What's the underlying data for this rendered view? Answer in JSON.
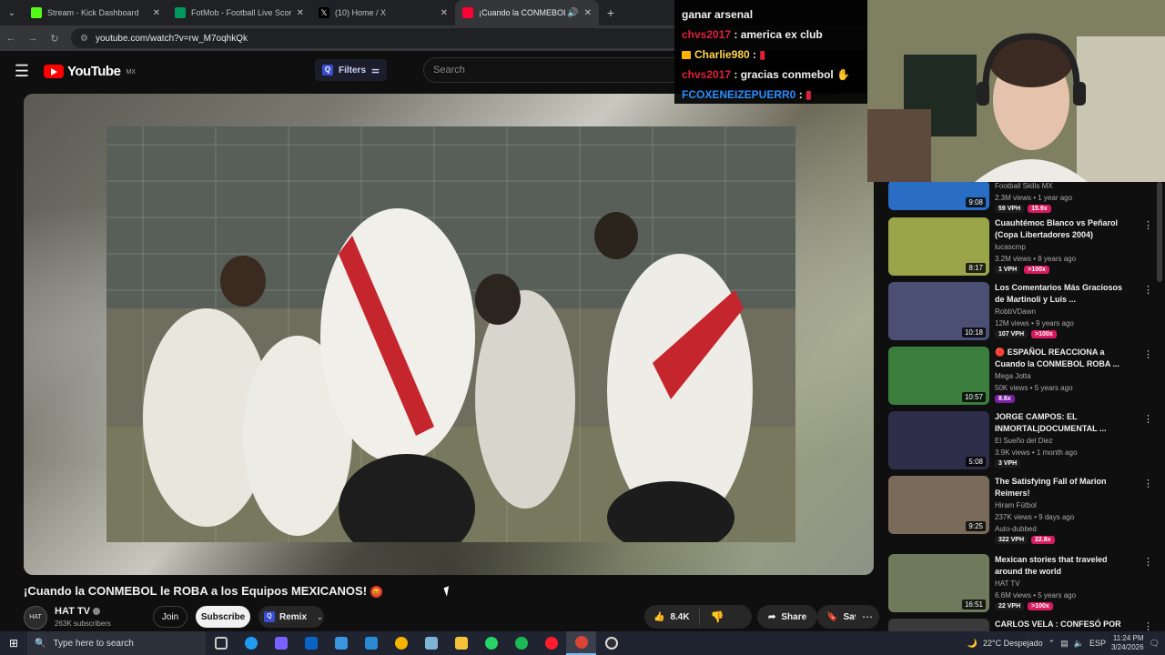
{
  "browser": {
    "tabs": [
      {
        "title": "Stream - Kick Dashboard",
        "favicon_color": "#53fc18",
        "active": false
      },
      {
        "title": "FotMob - Football Live Scores",
        "favicon_color": "#00985f",
        "active": false
      },
      {
        "title": "(10) Home / X",
        "favicon_color": "#000000",
        "active": false
      },
      {
        "title": "¡Cuando la CONMEBOL le R",
        "favicon_color": "#ff0033",
        "active": true
      }
    ],
    "new_tab": "+",
    "url": "youtube.com/watch?v=rw_M7oqhkQk"
  },
  "youtube": {
    "logo_text": "YouTube",
    "country_code": "MX",
    "filters_label": "Filters",
    "search_placeholder": "Search"
  },
  "chat": {
    "messages": [
      {
        "user": "",
        "text": "ganar arsenal"
      },
      {
        "user": "chvs2017",
        "text": " : america ex club"
      },
      {
        "user": "Charlie980",
        "text": " : "
      },
      {
        "user": "chvs2017",
        "text": " : gracias conmebol"
      },
      {
        "user": "FCOXENEIZEPUERR0",
        "text": " : "
      }
    ]
  },
  "video": {
    "title": "¡Cuando la CONMEBOL le ROBA a los Equipos MEXICANOS!",
    "channel": "HAT TV",
    "subscribers": "263K subscribers",
    "avatar_text": "HAT",
    "join_label": "Join",
    "subscribe_label": "Subscribe",
    "remix_label": "Remix",
    "likes": "8.4K",
    "share_label": "Share",
    "save_label": "Save"
  },
  "recommendations": [
    {
      "title": "",
      "channel": "Football Skills MX",
      "stats": "2.3M views • 1 year ago",
      "duration": "9:08",
      "vph": "59 VPH",
      "multiplier": "15.9x",
      "thumb_color": "#2a6dc4"
    },
    {
      "title": "Cuauhtémoc Blanco vs Peñarol (Copa Libertadores 2004)",
      "channel": "lucascmp",
      "stats": "3.2M views • 8 years ago",
      "duration": "8:17",
      "vph": "1 VPH",
      "multiplier": ">100x",
      "thumb_color": "#9aa54a"
    },
    {
      "title": "Los Comentarios Más Graciosos de Martinoli y Luis ...",
      "channel": "RobbVDawn",
      "stats": "12M views • 9 years ago",
      "duration": "10:18",
      "vph": "107 VPH",
      "multiplier": ">100x",
      "thumb_color": "#4b4f74"
    },
    {
      "title": "🔴 ESPAÑOL REACCIONA a Cuando la CONMEBOL ROBA ...",
      "channel": "Mega Jotta",
      "stats": "50K views • 5 years ago",
      "duration": "10:57",
      "vph": "",
      "multiplier": "8.6x",
      "thumb_color": "#3b7d3d"
    },
    {
      "title": "JORGE CAMPOS: EL INMORTAL|DOCUMENTAL ...",
      "channel": "El Sueño del Diez",
      "stats": "3.9K views • 1 month ago",
      "duration": "5:08",
      "vph": "3 VPH",
      "multiplier": "",
      "thumb_color": "#2e2d4a"
    },
    {
      "title": "The Satisfying Fall of Marion Reimers!",
      "channel": "Hiram Fútbol",
      "stats": "237K views • 9 days ago",
      "duration": "9:25",
      "vph": "322 VPH",
      "multiplier": "22.8x",
      "badge": "Auto-dubbed",
      "thumb_color": "#7a6a5a"
    },
    {
      "title": "Mexican stories that traveled around the world",
      "channel": "HAT TV",
      "stats": "6.6M views • 5 years ago",
      "duration": "16:51",
      "vph": "22 VPH",
      "multiplier": ">100x",
      "thumb_color": "#6e7a5b"
    },
    {
      "title": "CARLOS VELA : CONFESÓ POR",
      "channel": "",
      "stats": "",
      "duration": "",
      "vph": "",
      "multiplier": "",
      "thumb_color": "#3a3a3a"
    }
  ],
  "taskbar": {
    "search_placeholder": "Type here to search",
    "weather": "22°C  Despejado",
    "language": "ESP",
    "time": "11:24 PM",
    "date": "3/24/2026"
  }
}
